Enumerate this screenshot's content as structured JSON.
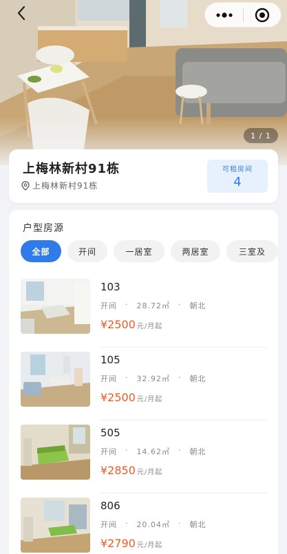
{
  "header": {
    "pager": "1 / 1"
  },
  "building": {
    "title": "上梅林新村91栋",
    "address": "上梅林新村91栋",
    "available_label": "可租房间",
    "available_count": "4"
  },
  "rooms_section": {
    "title": "户型房源",
    "filters": [
      "全部",
      "开间",
      "一居室",
      "两居室",
      "三室及"
    ],
    "active_filter": "全部"
  },
  "rooms": [
    {
      "number": "103",
      "type": "开间",
      "area": "28.72㎡",
      "orientation": "朝北",
      "price": "¥2500",
      "price_unit": "元/月起"
    },
    {
      "number": "105",
      "type": "开间",
      "area": "32.92㎡",
      "orientation": "朝北",
      "price": "¥2500",
      "price_unit": "元/月起"
    },
    {
      "number": "505",
      "type": "开间",
      "area": "14.62㎡",
      "orientation": "朝北",
      "price": "¥2850",
      "price_unit": "元/月起"
    },
    {
      "number": "806",
      "type": "开间",
      "area": "20.04㎡",
      "orientation": "朝北",
      "price": "¥2790",
      "price_unit": "元/月起"
    }
  ],
  "icons": {
    "back": "chevron-left-icon",
    "more": "more-dots-icon",
    "close_miniapp": "target-icon",
    "location": "location-pin-icon"
  },
  "colors": {
    "accent": "#2f7bea",
    "price": "#f15a22",
    "available_bg": "#e6f1fd"
  }
}
